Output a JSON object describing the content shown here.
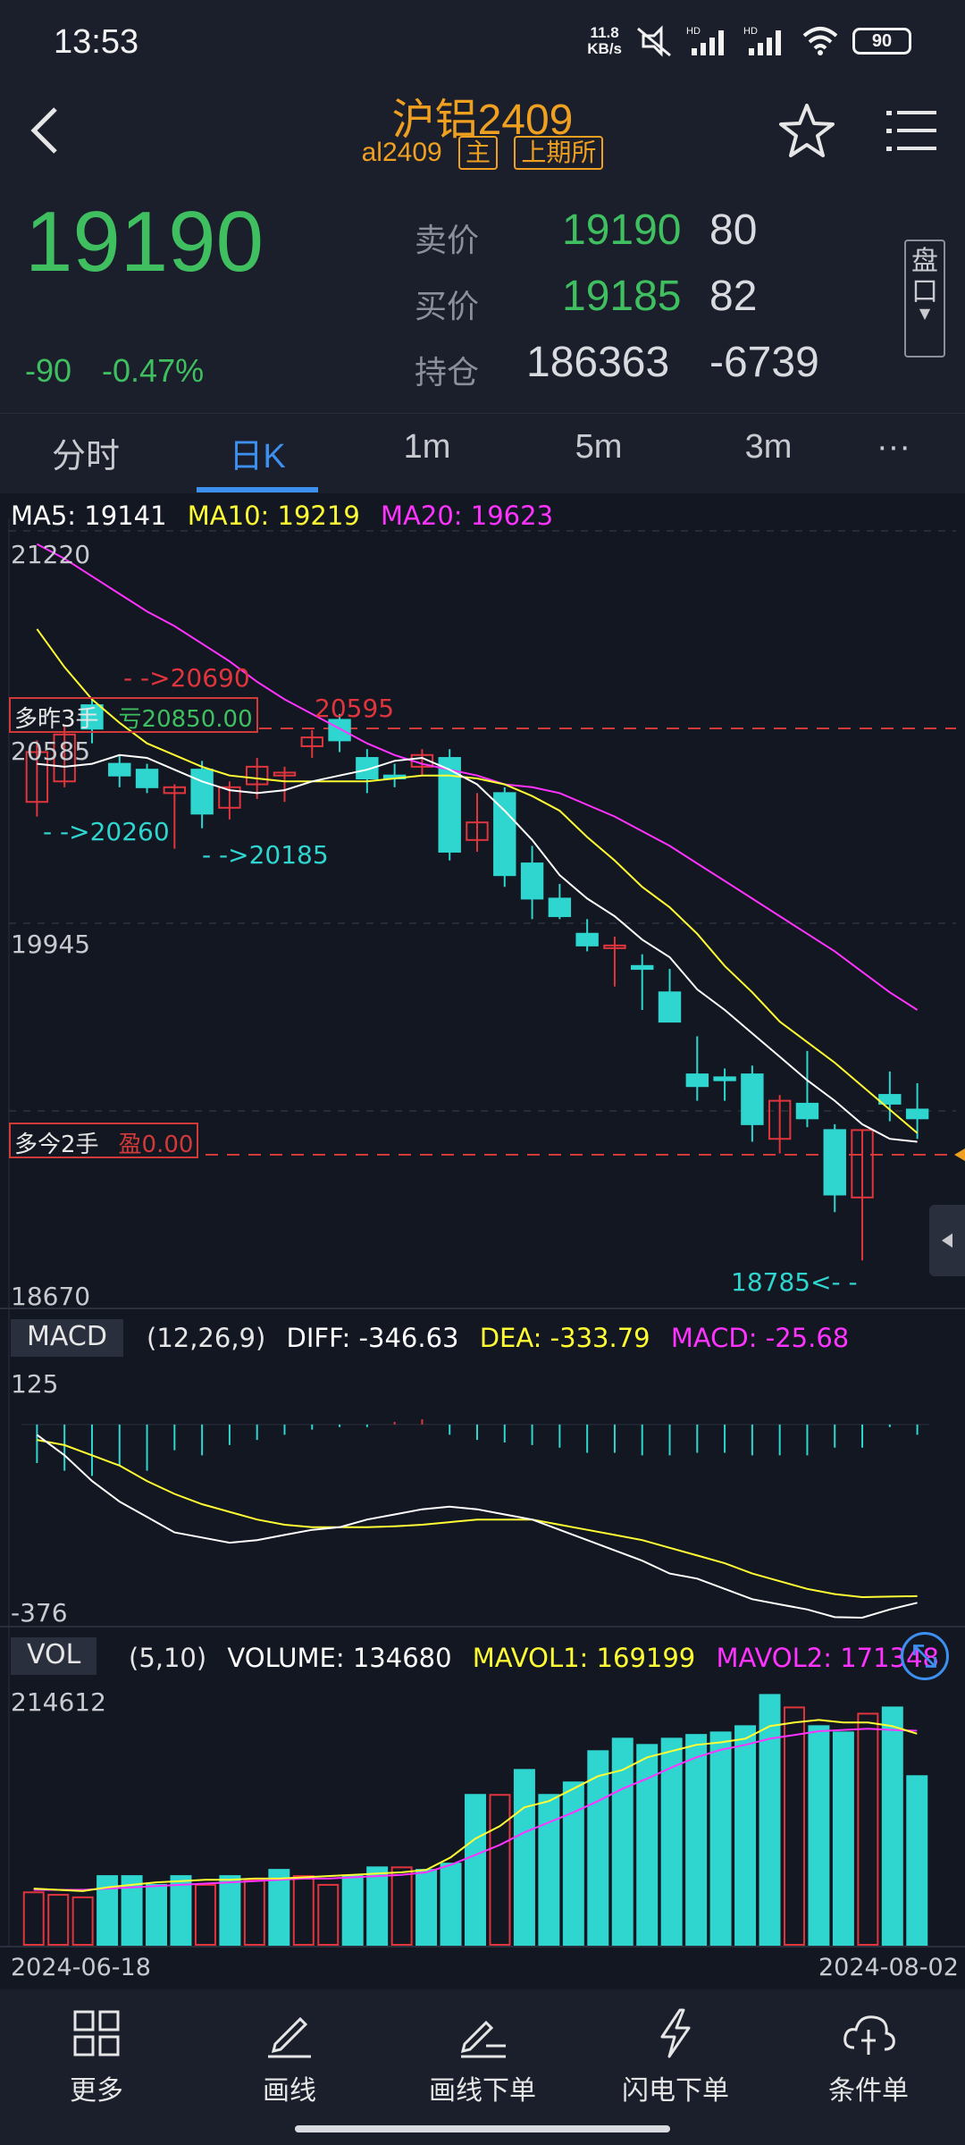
{
  "status": {
    "time": "13:53",
    "net_speed": "11.8",
    "net_unit": "KB/s",
    "battery": "90"
  },
  "header": {
    "title": "沪铝2409",
    "code": "al2409",
    "tag_main": "主",
    "tag_exchange": "上期所",
    "price": "19190",
    "change": "-90",
    "change_pct": "-0.47%",
    "pankou": "盘口"
  },
  "quotes": {
    "ask": {
      "label": "卖价",
      "price": "19190",
      "qty": "80"
    },
    "bid": {
      "label": "买价",
      "price": "19185",
      "qty": "82"
    },
    "hold": {
      "label": "持仓",
      "value": "186363",
      "change": "-6739"
    }
  },
  "tabs": [
    "分时",
    "日K",
    "1m",
    "5m",
    "3m",
    "···"
  ],
  "active_tab": "日K",
  "kline": {
    "ma5_label": "MA5: 19141",
    "ma10_label": "MA10: 19219",
    "ma20_label": "MA20: 19623",
    "y_top": "21220",
    "y_mid1": "20585",
    "y_mid2": "19945",
    "y_bottom": "18670",
    "marks": {
      "hi1": "- ->20690",
      "hi2": "20595",
      "lo1": "- ->20260",
      "lo2": "- ->20185",
      "lo3": "18785<- -"
    },
    "position_yesterday": {
      "label": "多昨3手",
      "pl": "亏20850.00"
    },
    "position_today": {
      "label": "多今2手",
      "pl": "盈0.00"
    }
  },
  "macd": {
    "name": "MACD",
    "params": "(12,26,9)",
    "diff": "DIFF: -346.63",
    "dea": "DEA: -333.79",
    "macd": "MACD: -25.68",
    "y_top": "125",
    "y_bottom": "-376"
  },
  "vol": {
    "name": "VOL",
    "params": "(5,10)",
    "volume": "VOLUME: 134680",
    "mavol1": "MAVOL1: 169199",
    "mavol2": "MAVOL2: 171348",
    "y_top": "214612"
  },
  "dates": {
    "start": "2024-06-18",
    "end": "2024-08-02"
  },
  "toolbar": [
    {
      "label": "更多",
      "icon": "grid-icon"
    },
    {
      "label": "画线",
      "icon": "pen-icon"
    },
    {
      "label": "画线下单",
      "icon": "pen-order-icon"
    },
    {
      "label": "闪电下单",
      "icon": "lightning-icon"
    },
    {
      "label": "条件单",
      "icon": "cloud-icon"
    }
  ],
  "colors": {
    "up": "#e0353d",
    "down": "#2fd6d0",
    "ma5": "#ffffff",
    "ma10": "#ffff33",
    "ma20": "#ff33ff",
    "accent": "#3d8ff0",
    "price_green": "#3fbf5f"
  },
  "chart_data": {
    "type": "candlestick",
    "price_range": [
      18670,
      21220
    ],
    "candles": [
      {
        "o": 20350,
        "h": 20560,
        "l": 20300,
        "c": 20520
      },
      {
        "o": 20420,
        "h": 20610,
        "l": 20400,
        "c": 20580
      },
      {
        "o": 20680,
        "h": 20700,
        "l": 20550,
        "c": 20600
      },
      {
        "o": 20480,
        "h": 20510,
        "l": 20400,
        "c": 20440
      },
      {
        "o": 20460,
        "h": 20480,
        "l": 20380,
        "c": 20400
      },
      {
        "o": 20380,
        "h": 20410,
        "l": 20190,
        "c": 20400
      },
      {
        "o": 20460,
        "h": 20490,
        "l": 20260,
        "c": 20310
      },
      {
        "o": 20330,
        "h": 20420,
        "l": 20290,
        "c": 20400
      },
      {
        "o": 20410,
        "h": 20500,
        "l": 20360,
        "c": 20470
      },
      {
        "o": 20440,
        "h": 20470,
        "l": 20350,
        "c": 20450
      },
      {
        "o": 20540,
        "h": 20595,
        "l": 20500,
        "c": 20570
      },
      {
        "o": 20630,
        "h": 20650,
        "l": 20520,
        "c": 20560
      },
      {
        "o": 20500,
        "h": 20530,
        "l": 20380,
        "c": 20430
      },
      {
        "o": 20440,
        "h": 20480,
        "l": 20400,
        "c": 20430
      },
      {
        "o": 20470,
        "h": 20530,
        "l": 20440,
        "c": 20510
      },
      {
        "o": 20500,
        "h": 20530,
        "l": 20150,
        "c": 20180
      },
      {
        "o": 20220,
        "h": 20380,
        "l": 20180,
        "c": 20280
      },
      {
        "o": 20380,
        "h": 20400,
        "l": 20060,
        "c": 20100
      },
      {
        "o": 20140,
        "h": 20200,
        "l": 19950,
        "c": 20020
      },
      {
        "o": 20020,
        "h": 20070,
        "l": 19950,
        "c": 19960
      },
      {
        "o": 19900,
        "h": 19950,
        "l": 19840,
        "c": 19860
      },
      {
        "o": 19860,
        "h": 19890,
        "l": 19720,
        "c": 19860
      },
      {
        "o": 19790,
        "h": 19830,
        "l": 19640,
        "c": 19780
      },
      {
        "o": 19700,
        "h": 19780,
        "l": 19650,
        "c": 19600
      },
      {
        "o": 19420,
        "h": 19550,
        "l": 19330,
        "c": 19380
      },
      {
        "o": 19410,
        "h": 19440,
        "l": 19330,
        "c": 19400
      },
      {
        "o": 19420,
        "h": 19450,
        "l": 19190,
        "c": 19250
      },
      {
        "o": 19200,
        "h": 19350,
        "l": 19150,
        "c": 19330
      },
      {
        "o": 19320,
        "h": 19500,
        "l": 19240,
        "c": 19270
      },
      {
        "o": 19230,
        "h": 19250,
        "l": 18950,
        "c": 19010
      },
      {
        "o": 19000,
        "h": 19230,
        "l": 18785,
        "c": 19230
      },
      {
        "o": 19350,
        "h": 19430,
        "l": 19260,
        "c": 19320
      },
      {
        "o": 19300,
        "h": 19390,
        "l": 19200,
        "c": 19270
      }
    ],
    "ma5": [
      20480,
      20470,
      20480,
      20510,
      20500,
      20460,
      20420,
      20390,
      20380,
      20390,
      20420,
      20440,
      20460,
      20490,
      20500,
      20460,
      20410,
      20320,
      20220,
      20100,
      20020,
      19960,
      19880,
      19820,
      19710,
      19640,
      19560,
      19480,
      19400,
      19330,
      19250,
      19200,
      19190
    ],
    "ma10": [
      20940,
      20810,
      20700,
      20620,
      20550,
      20510,
      20470,
      20440,
      20430,
      20420,
      20420,
      20420,
      20420,
      20430,
      20440,
      20440,
      20430,
      20410,
      20370,
      20320,
      20230,
      20150,
      20060,
      19990,
      19900,
      19790,
      19700,
      19600,
      19530,
      19460,
      19380,
      19300,
      19220
    ],
    "ma20": [
      21230,
      21180,
      21120,
      21060,
      21000,
      20950,
      20890,
      20830,
      20760,
      20700,
      20650,
      20600,
      20550,
      20510,
      20480,
      20460,
      20440,
      20410,
      20400,
      20380,
      20340,
      20300,
      20250,
      20200,
      20140,
      20080,
      20020,
      19960,
      19900,
      19840,
      19770,
      19700,
      19640
    ],
    "macd_range": [
      -376,
      125
    ],
    "macd_hist": [
      -75,
      -90,
      -100,
      -80,
      -90,
      -50,
      -60,
      -40,
      -30,
      -20,
      -10,
      -5,
      -5,
      5,
      10,
      -20,
      -30,
      -35,
      -40,
      -45,
      -55,
      -55,
      -60,
      -60,
      -55,
      -55,
      -60,
      -60,
      -60,
      -45,
      -45,
      -5,
      -20
    ],
    "diff": [
      -20,
      -60,
      -110,
      -150,
      -180,
      -210,
      -220,
      -230,
      -225,
      -215,
      -205,
      -200,
      -185,
      -175,
      -165,
      -160,
      -165,
      -175,
      -185,
      -205,
      -225,
      -245,
      -265,
      -290,
      -300,
      -320,
      -340,
      -350,
      -360,
      -375,
      -376,
      -360,
      -347
    ],
    "dea": [
      -30,
      -40,
      -60,
      -80,
      -110,
      -135,
      -155,
      -170,
      -185,
      -195,
      -200,
      -200,
      -200,
      -198,
      -195,
      -190,
      -185,
      -185,
      -185,
      -195,
      -205,
      -215,
      -225,
      -240,
      -255,
      -270,
      -290,
      -305,
      -320,
      -330,
      -336,
      -335,
      -334
    ],
    "vol_range": [
      0,
      214612
    ],
    "volume": [
      42000,
      40000,
      38000,
      55000,
      55000,
      48000,
      55000,
      48000,
      55000,
      52000,
      60000,
      55000,
      48000,
      55000,
      62000,
      62000,
      60000,
      65000,
      120000,
      120000,
      140000,
      120000,
      130000,
      155000,
      165000,
      160000,
      165000,
      168000,
      170000,
      175000,
      200000,
      190000,
      175000,
      170000,
      185000,
      190000,
      135000
    ],
    "vol_up": [
      true,
      true,
      true,
      false,
      false,
      false,
      false,
      true,
      false,
      true,
      false,
      true,
      true,
      false,
      false,
      true,
      false,
      false,
      false,
      true,
      false,
      false,
      false,
      false,
      false,
      false,
      false,
      false,
      false,
      false,
      false,
      true,
      false,
      false,
      true,
      false,
      false
    ],
    "mavol1": [
      45000,
      44000,
      43000,
      46000,
      48000,
      50000,
      51000,
      52000,
      52000,
      53000,
      53000,
      54000,
      55000,
      56000,
      57000,
      58000,
      60000,
      70000,
      85000,
      95000,
      110000,
      115000,
      125000,
      135000,
      140000,
      150000,
      155000,
      160000,
      162000,
      165000,
      175000,
      178000,
      180000,
      178000,
      178000,
      175000,
      169000
    ],
    "mavol2": [
      44000,
      44000,
      44000,
      45000,
      46000,
      47000,
      48000,
      49000,
      50000,
      51000,
      52000,
      53000,
      53000,
      54000,
      55000,
      56000,
      58000,
      64000,
      72000,
      80000,
      90000,
      98000,
      106000,
      115000,
      125000,
      133000,
      142000,
      150000,
      156000,
      160000,
      165000,
      168000,
      171000,
      172000,
      173000,
      172000,
      171348
    ]
  }
}
